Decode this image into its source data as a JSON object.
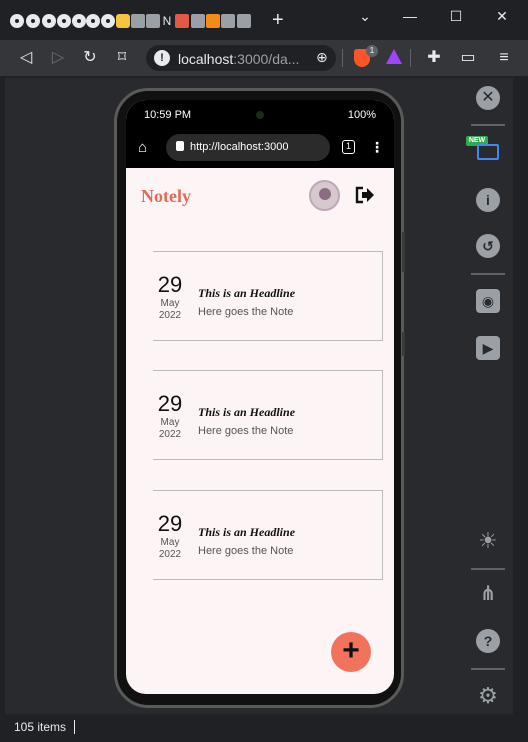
{
  "browser": {
    "tab_icons": [
      "chrome-c",
      "chrome-c",
      "chrome-c",
      "chrome-c",
      "chrome-c",
      "chrome-c",
      "chrome-c",
      "hand-icon",
      "bookmark-icon",
      "bookmark-icon",
      "notion-icon",
      "red-square",
      "bookmark-icon",
      "bookmark-orange",
      "bookmark-icon",
      "bookmark-icon"
    ],
    "notion_letter": "N",
    "new_tab_symbol": "+",
    "url_host": "localhost",
    "url_rest": ":3000/da...",
    "brave_badge": "1",
    "window_controls": [
      "⌄",
      "—",
      "☐",
      "✕"
    ]
  },
  "status_bar": {
    "items_count": "105 items"
  },
  "mobile": {
    "status": {
      "time": "10:59 PM",
      "battery": "100%"
    },
    "url": "http://localhost:3000",
    "tab_count": "1",
    "app": {
      "logo": "Notely",
      "notes": [
        {
          "day": "29",
          "month": "May",
          "year": "2022",
          "headline": "This is an Headline",
          "body": "Here goes the Note"
        },
        {
          "day": "29",
          "month": "May",
          "year": "2022",
          "headline": "This is an Headline",
          "body": "Here goes the Note"
        },
        {
          "day": "29",
          "month": "May",
          "year": "2022",
          "headline": "This is an Headline",
          "body": "Here goes the Note"
        }
      ],
      "fab_label": "+"
    }
  },
  "devtools": {
    "new_badge": "NEW"
  },
  "colors": {
    "accent": "#e06b57",
    "fab": "#f2735c",
    "chrome_bg": "#202124"
  }
}
